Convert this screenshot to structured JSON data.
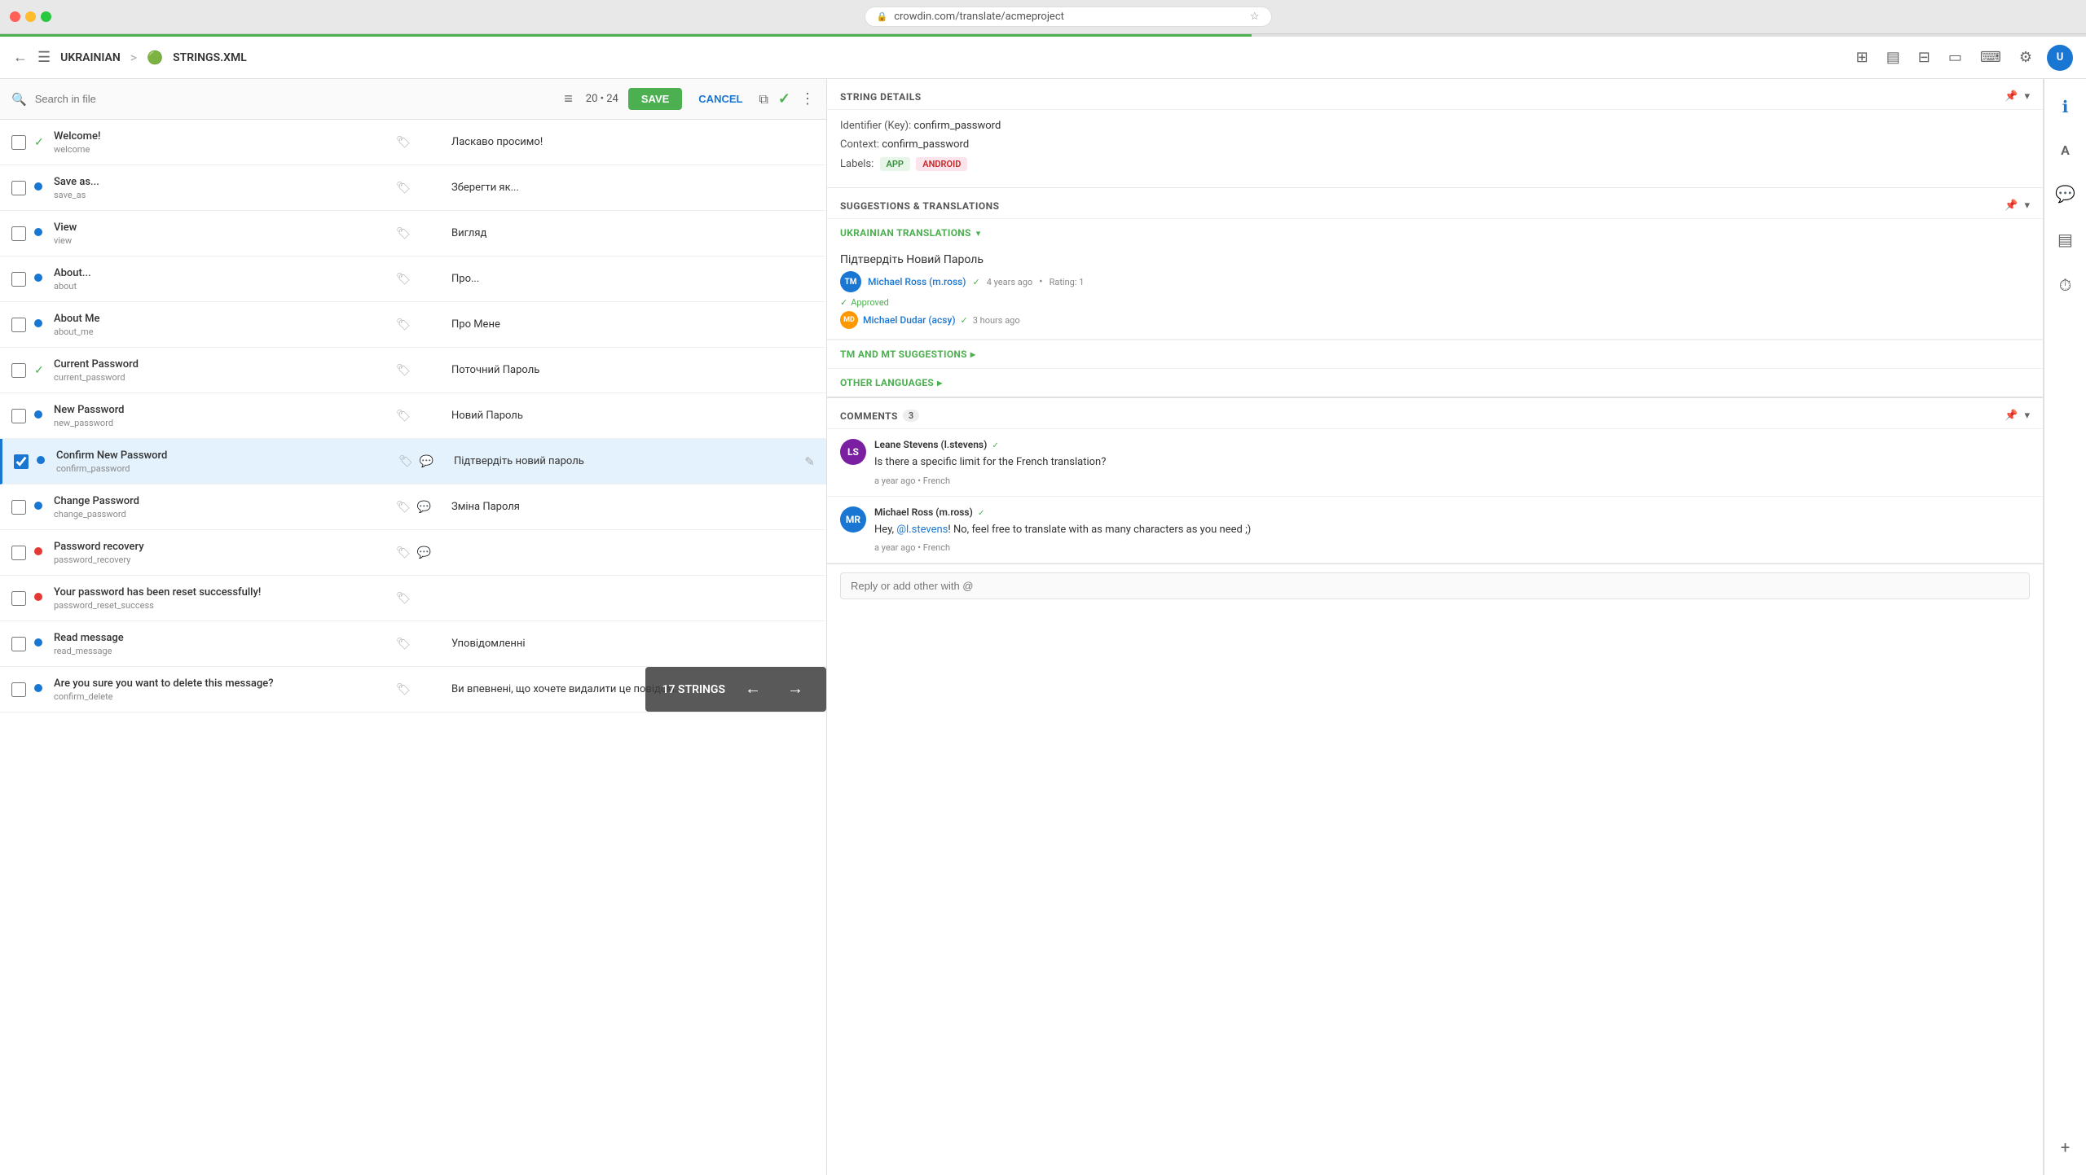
{
  "browser": {
    "url": "crowdin.com/translate/acmeproject",
    "favicon": "🔒"
  },
  "toolbar": {
    "back_label": "←",
    "menu_label": "☰",
    "language": "UKRAINIAN",
    "separator": ">",
    "file_name": "STRINGS.XML",
    "save_label": "SAVE",
    "cancel_label": "CANCEL"
  },
  "search": {
    "placeholder": "Search in file",
    "filter_icon": "⚙",
    "count": "20 • 24"
  },
  "strings": [
    {
      "id": 1,
      "status": "approved",
      "source": "Welcome!",
      "key": "welcome",
      "tag_icon": true,
      "translation": "Ласкаво просимо!",
      "active": false
    },
    {
      "id": 2,
      "status": "translated",
      "source": "Save as...",
      "key": "save_as",
      "tag_icon": true,
      "translation": "Зберегти як...",
      "active": false
    },
    {
      "id": 3,
      "status": "translated",
      "source": "View",
      "key": "view",
      "tag_icon": true,
      "translation": "Вигляд",
      "active": false
    },
    {
      "id": 4,
      "status": "translated",
      "source": "About...",
      "key": "about",
      "tag_icon": true,
      "translation": "Про...",
      "active": false
    },
    {
      "id": 5,
      "status": "translated",
      "source": "About Me",
      "key": "about_me",
      "tag_icon": true,
      "translation": "Про Мене",
      "active": false
    },
    {
      "id": 6,
      "status": "approved",
      "source": "Current Password",
      "key": "current_password",
      "tag_icon": true,
      "translation": "Поточний Пароль",
      "active": false
    },
    {
      "id": 7,
      "status": "translated",
      "source": "New Password",
      "key": "new_password",
      "tag_icon": true,
      "translation": "Новий Пароль",
      "active": false
    },
    {
      "id": 8,
      "status": "active",
      "source": "Confirm New Password",
      "key": "confirm_password",
      "tag_icon": true,
      "comment_icon": true,
      "translation": "Підтвердіть новий пароль",
      "active": true
    },
    {
      "id": 9,
      "status": "translated",
      "source": "Change Password",
      "key": "change_password",
      "tag_icon": true,
      "comment_icon": true,
      "translation": "Зміна Пароля",
      "active": false
    },
    {
      "id": 10,
      "status": "untranslated",
      "source": "Password recovery",
      "key": "password_recovery",
      "tag_icon": true,
      "comment_icon": true,
      "translation": "",
      "active": false
    },
    {
      "id": 11,
      "status": "untranslated",
      "source": "Your password has been reset successfully!",
      "key": "password_reset_success",
      "tag_icon": true,
      "translation": "",
      "active": false
    },
    {
      "id": 12,
      "status": "translated",
      "source": "Read message",
      "key": "read_message",
      "tag_icon": true,
      "translation": "Уповідомленні",
      "active": false
    },
    {
      "id": 13,
      "status": "translated",
      "source": "Are you sure you want to delete this message?",
      "key": "confirm_delete",
      "tag_icon": true,
      "translation": "Ви впевнені, що хочете видалити це повідомлення?",
      "active": false
    }
  ],
  "bottom_bar": {
    "label": "17 STRINGS",
    "prev": "←",
    "next": "→"
  },
  "string_details": {
    "title": "STRING DETAILS",
    "identifier_label": "Identifier (Key):",
    "identifier_value": "confirm_password",
    "context_label": "Context:",
    "context_value": "confirm_password",
    "labels_label": "Labels:",
    "label_app": "APP",
    "label_android": "ANDROID"
  },
  "suggestions": {
    "title": "SUGGESTIONS & TRANSLATIONS",
    "ukrainian_label": "UKRAINIAN TRANSLATIONS",
    "suggestion_text": "Підтвердіть Новий Пароль",
    "author": "Michael Ross (m.ross)",
    "author_initials": "TM",
    "time": "4 years ago",
    "rating": "Rating: 1",
    "approved_label": "Approved",
    "approver": "Michael Dudar (acsy)",
    "approver_initials": "MD",
    "approver_time": "3 hours ago",
    "tm_label": "TM AND MT SUGGESTIONS",
    "other_label": "OTHER LANGUAGES"
  },
  "comments": {
    "title": "COMMENTS",
    "count": "3",
    "items": [
      {
        "author": "Leane Stevens (l.stevens)",
        "author_initials": "LS",
        "verified": true,
        "text": "Is there a specific limit for the French translation?",
        "time": "a year ago",
        "lang": "French"
      },
      {
        "author": "Michael Ross (m.ross)",
        "author_initials": "MR",
        "verified": true,
        "text": "@l.stevens! No, feel free to translate with as many characters as you need ;)",
        "mention": "@l.stevens",
        "time": "a year ago",
        "lang": "French"
      }
    ],
    "reply_placeholder": "Reply or add other with @"
  },
  "icon_sidebar": {
    "info_icon": "ℹ",
    "translate_icon": "A",
    "comment_icon": "💬",
    "layers_icon": "▤",
    "history_icon": "⏱",
    "add_icon": "+"
  }
}
